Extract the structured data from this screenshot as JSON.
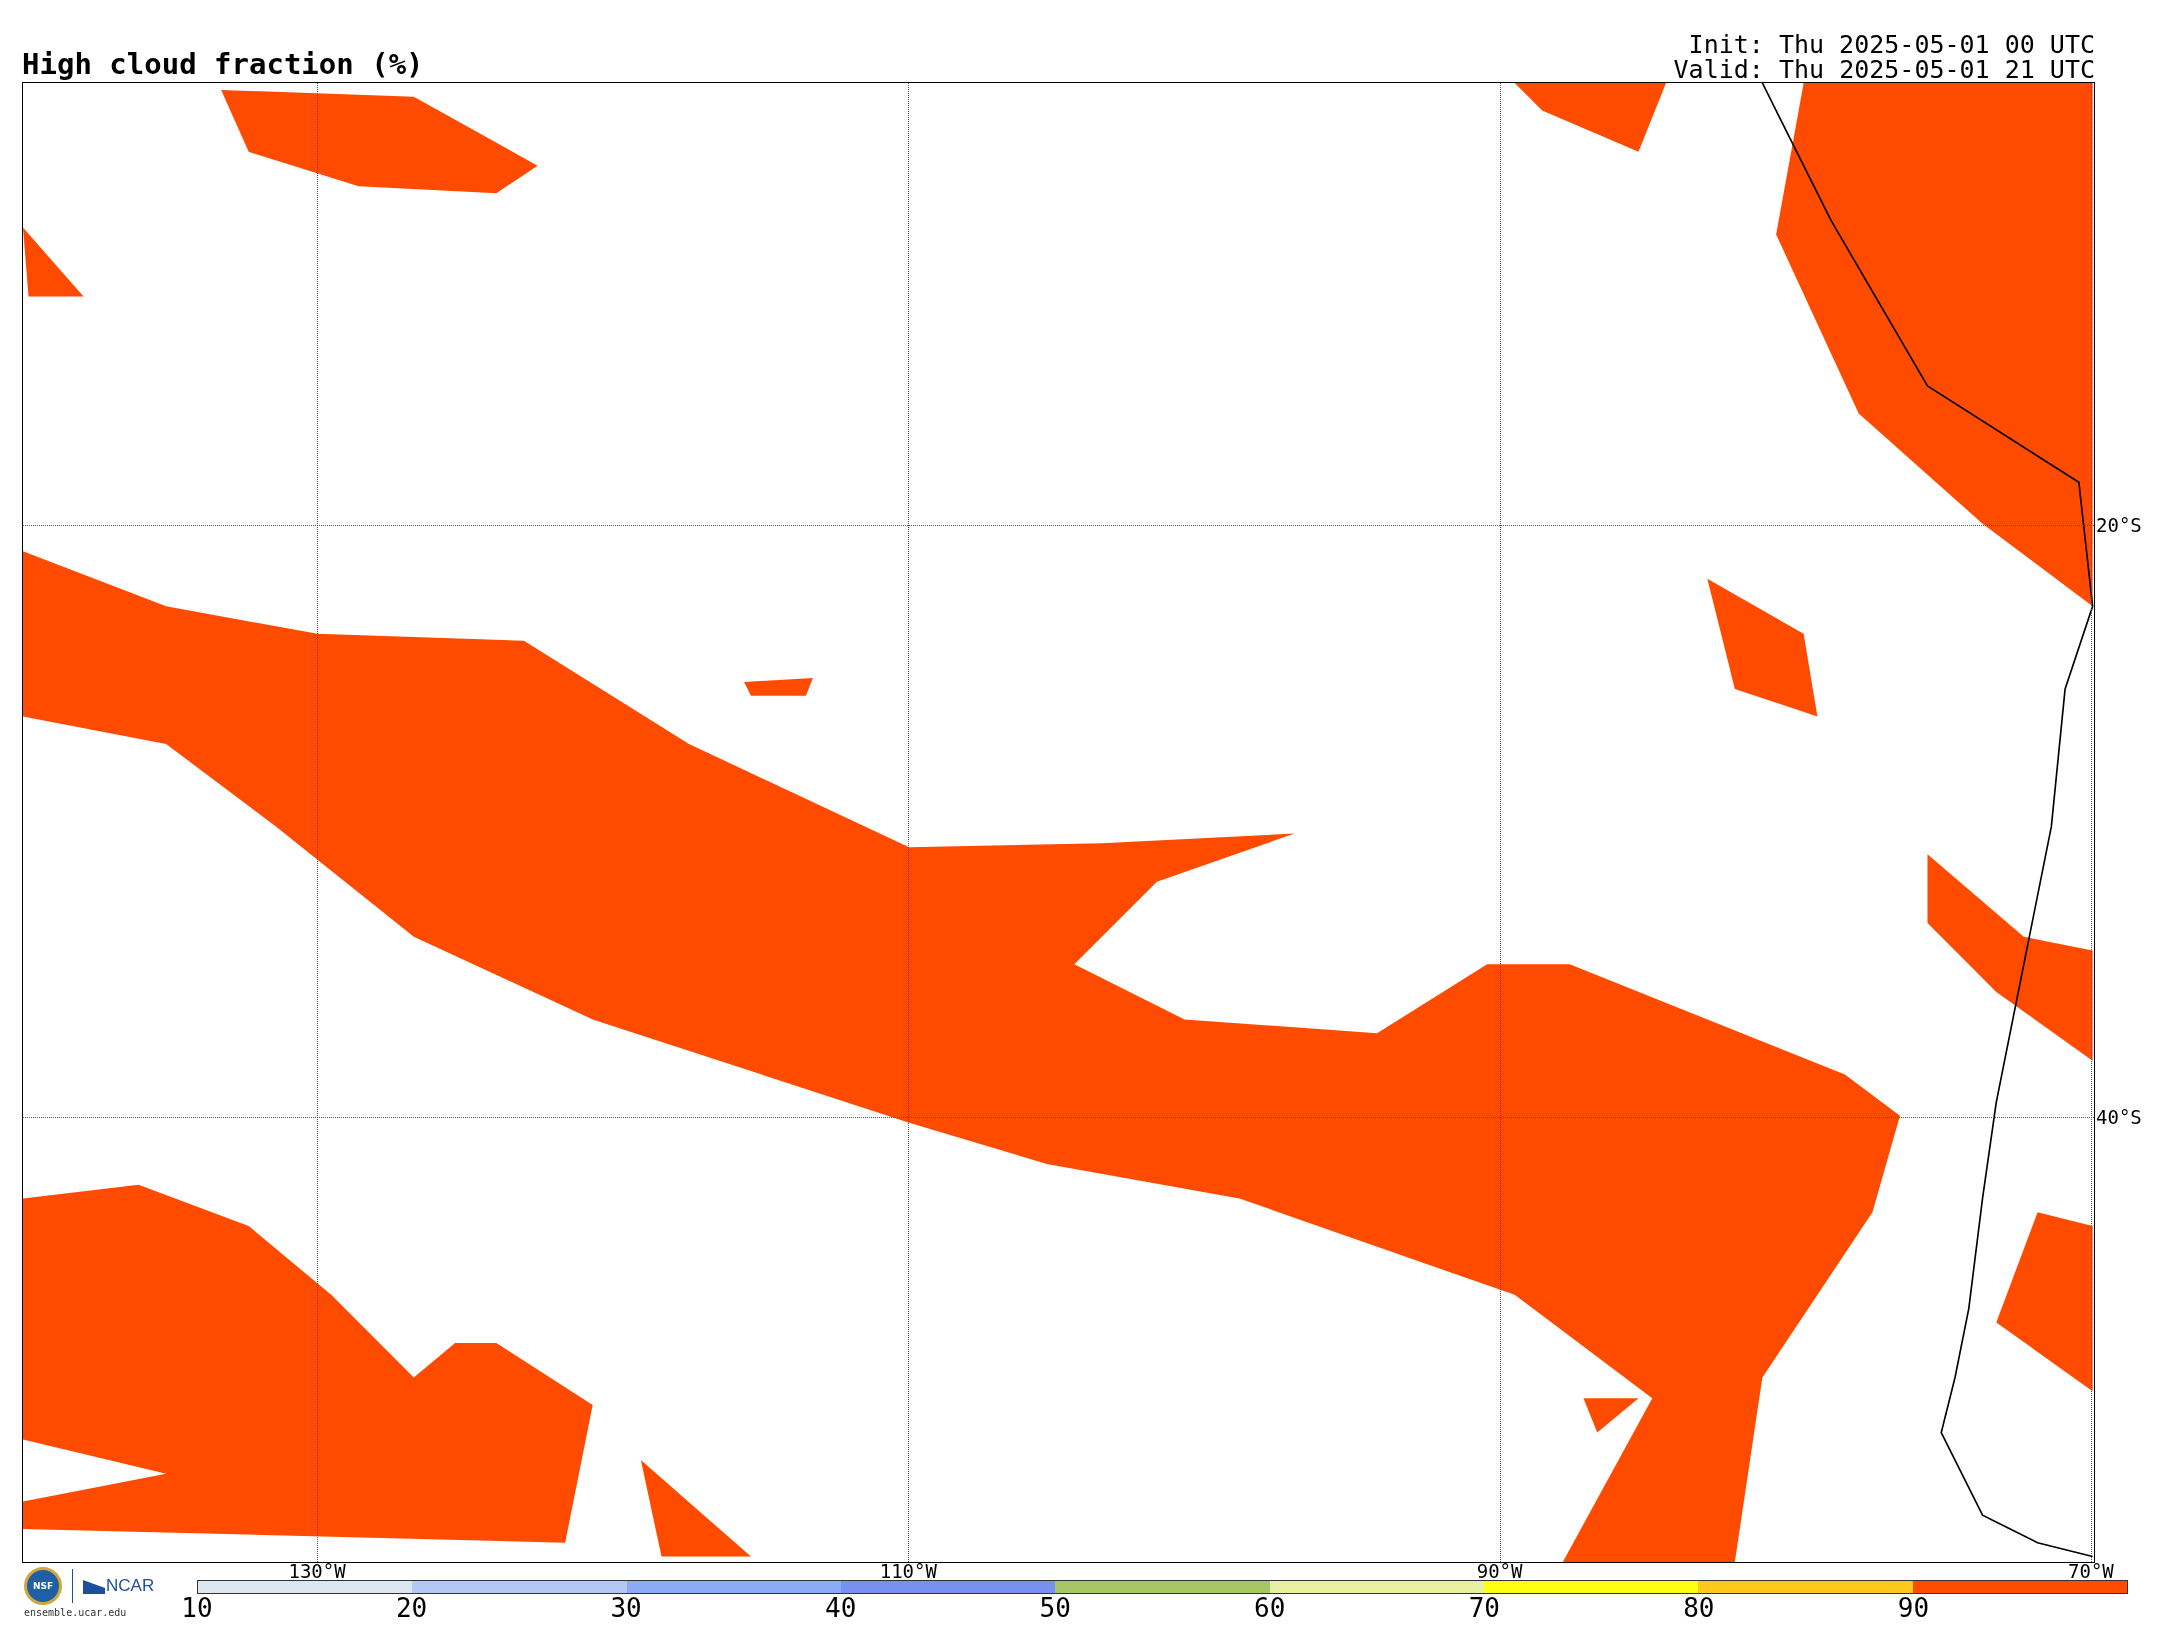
{
  "header": {
    "title": "High cloud fraction (%)",
    "init": "Init: Thu 2025-05-01 00 UTC",
    "valid": "Valid: Thu 2025-05-01 21 UTC"
  },
  "map": {
    "lon_labels": [
      "130°W",
      "110°W",
      "90°W",
      "70°W"
    ],
    "lat_labels": [
      "20°S",
      "40°S"
    ]
  },
  "branding": {
    "emblem": "NSF",
    "logo": "NCAR",
    "url": "ensemble.ucar.edu"
  },
  "colorbar": {
    "bins": [
      {
        "color": "#dce6ef"
      },
      {
        "color": "#b4c8f5"
      },
      {
        "color": "#8caaf5"
      },
      {
        "color": "#7890f0"
      },
      {
        "color": "#a5c864"
      },
      {
        "color": "#e6f0a0"
      },
      {
        "color": "#ffff14"
      },
      {
        "color": "#ffc81e"
      },
      {
        "color": "#ff4b00"
      }
    ],
    "ticks": [
      "10",
      "20",
      "30",
      "40",
      "50",
      "60",
      "70",
      "80",
      "90"
    ]
  }
}
